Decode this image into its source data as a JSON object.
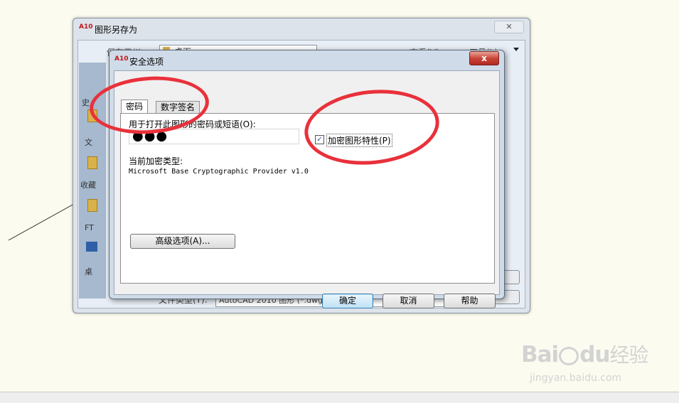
{
  "outer_window": {
    "title": "图形另存为",
    "app_icon": "A10",
    "close_label": "✕",
    "save_in_label": "保存于(I):",
    "location_value": "桌面",
    "views_label": "查看(V)",
    "tools_label": "工具(L)",
    "side_items": [
      "史",
      "文",
      "收藏",
      "FT",
      "桌"
    ],
    "filetype_label": "文件类型(T):",
    "filetype_value": "AutoCAD 2010 图形 (*.dwg)"
  },
  "security_dialog": {
    "title": "安全选项",
    "app_icon": "A10",
    "close_label": "x",
    "tabs": [
      "密码",
      "数字签名"
    ],
    "password_prompt": "用于打开此图形的密码或短语(O):",
    "password_value": "●●●",
    "encrypt_checkbox_label": "加密图形特性(P)",
    "encrypt_checked": true,
    "encryption_type_label": "当前加密类型:",
    "encryption_type_value": "Microsoft Base Cryptographic Provider v1.0",
    "advanced_button": "高级选项(A)...",
    "ok_button": "确定",
    "cancel_button": "取消",
    "help_button": "帮助"
  },
  "watermark": {
    "brand": "Bai",
    "brand_du": "du",
    "suffix": "经验",
    "url": "jingyan.baidu.com"
  },
  "colors": {
    "annotation_red": "#e9313b",
    "page_background": "#fcfbf0"
  }
}
